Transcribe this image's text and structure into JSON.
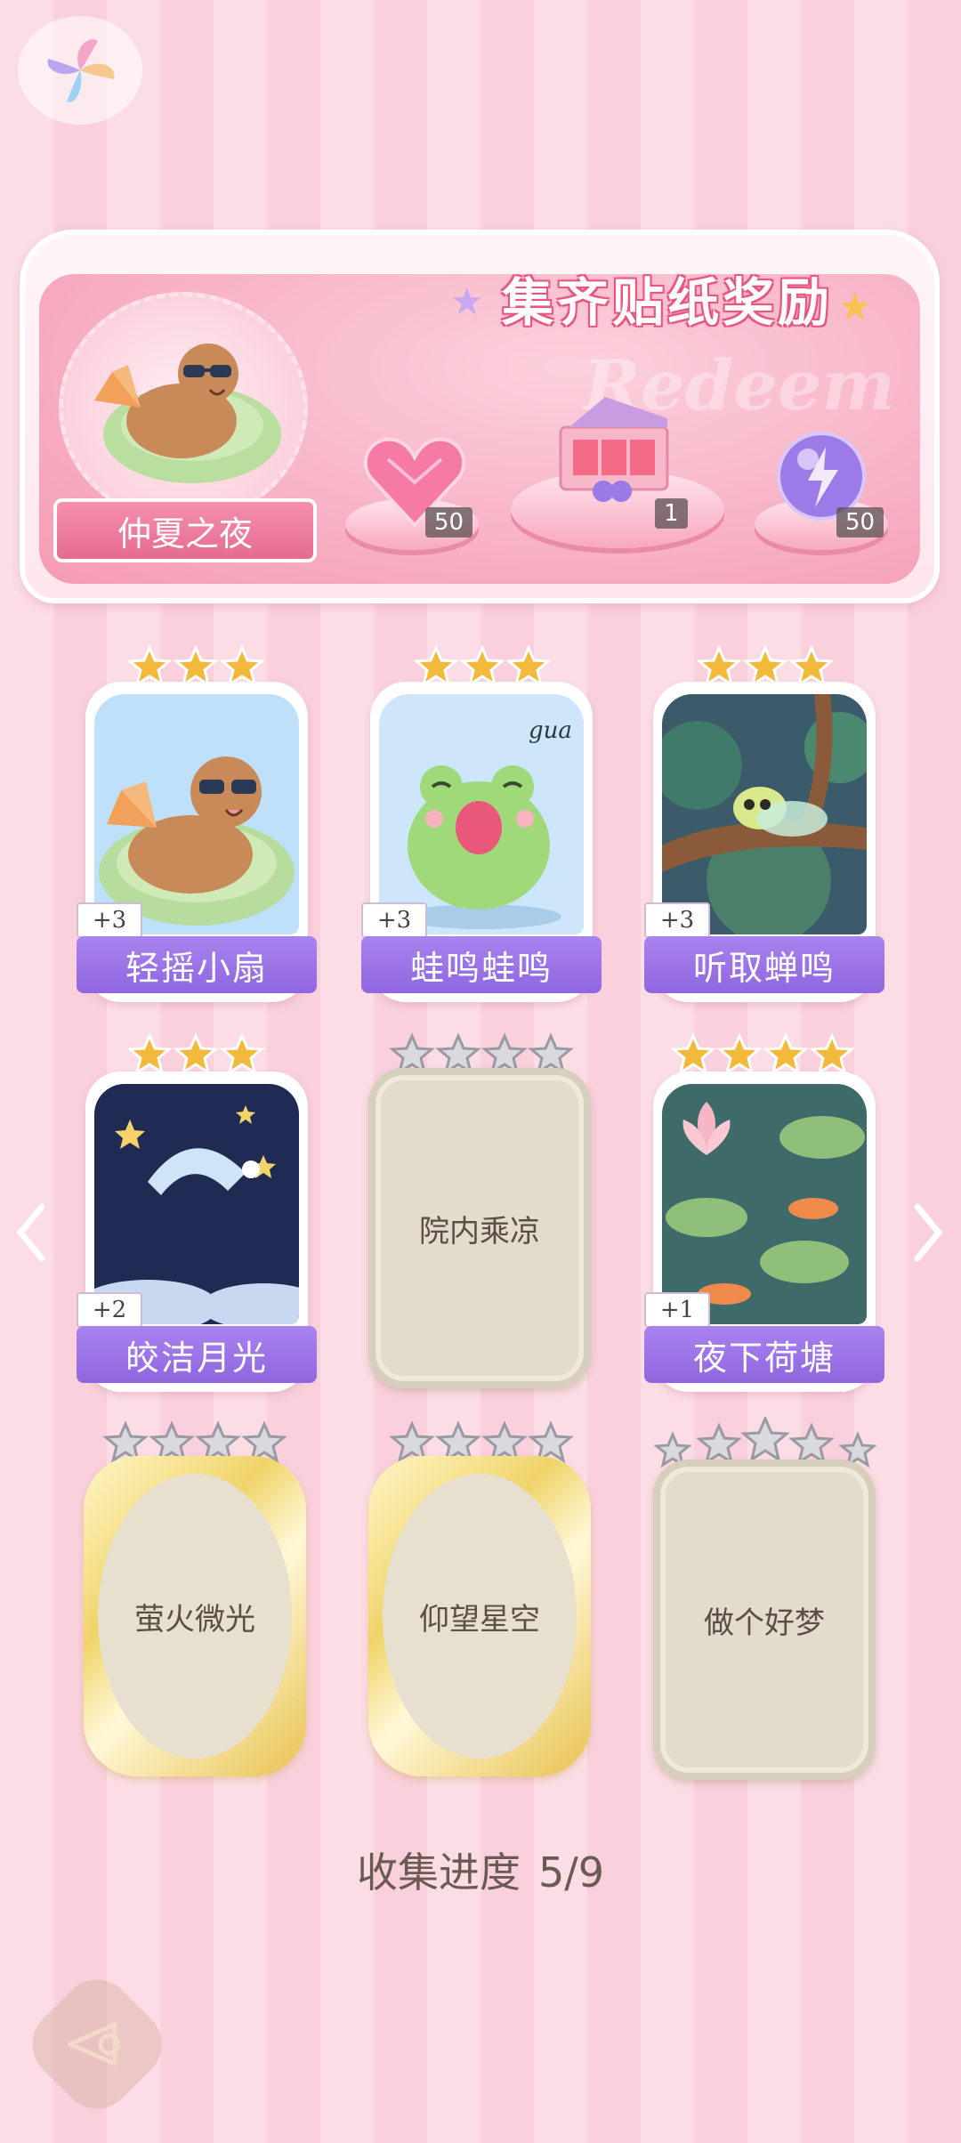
{
  "banner": {
    "title": "集齐贴纸奖励",
    "watermark": "Redeem",
    "theme_name": "仲夏之夜",
    "rewards": [
      {
        "icon": "heart-gem-icon",
        "count": "50"
      },
      {
        "icon": "gift-box-icon",
        "count": "1"
      },
      {
        "icon": "energy-orb-icon",
        "count": "50"
      }
    ]
  },
  "cards": [
    {
      "name": "轻摇小扇",
      "bonus": "+3",
      "stars": 3,
      "collected": true,
      "icon": "capybara-fan-icon"
    },
    {
      "name": "蛙鸣蛙鸣",
      "bonus": "+3",
      "stars": 3,
      "collected": true,
      "icon": "frog-icon",
      "caption": "gua"
    },
    {
      "name": "听取蝉鸣",
      "bonus": "+3",
      "stars": 3,
      "collected": true,
      "icon": "cicada-icon"
    },
    {
      "name": "皎洁月光",
      "bonus": "+2",
      "stars": 3,
      "collected": true,
      "icon": "moon-icon"
    },
    {
      "name": "院内乘凉",
      "stars": 4,
      "collected": false,
      "frame": "silver"
    },
    {
      "name": "夜下荷塘",
      "bonus": "+1",
      "stars": 4,
      "collected": true,
      "icon": "lotus-pond-icon"
    },
    {
      "name": "萤火微光",
      "stars": 4,
      "collected": false,
      "frame": "gold"
    },
    {
      "name": "仰望星空",
      "stars": 4,
      "collected": false,
      "frame": "gold"
    },
    {
      "name": "做个好梦",
      "stars": 5,
      "collected": false,
      "frame": "silver"
    }
  ],
  "progress": {
    "label": "收集进度",
    "value": "5/9"
  },
  "colors": {
    "accent": "#9a70e6",
    "pink": "#f7a9bf",
    "gold_star": "#f3b93a"
  }
}
